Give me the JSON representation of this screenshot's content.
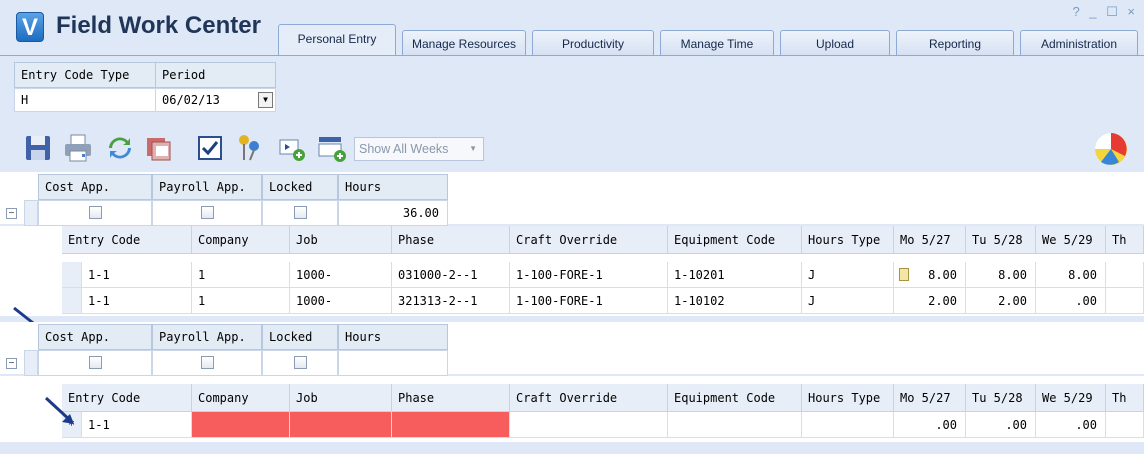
{
  "app": {
    "title": "Field Work Center",
    "logo_letter": "V",
    "window_controls": "? _ ☐ ×"
  },
  "tabs": [
    "Personal Entry",
    "Manage Resources",
    "Productivity",
    "Manage Time",
    "Upload",
    "Reporting",
    "Administration"
  ],
  "filters": {
    "entry_code_type_label": "Entry Code Type",
    "entry_code_type_value": "H",
    "period_label": "Period",
    "period_value": "06/02/13"
  },
  "toolbar": {
    "icons": [
      "save-icon",
      "print-icon",
      "refresh-icon",
      "calendar-icon",
      "checkbox-icon",
      "pin-icon",
      "add-row-icon",
      "add-list-icon",
      "beach-ball-icon"
    ],
    "show_weeks": "Show All Weeks"
  },
  "group_headers": {
    "cost_app": "Cost App.",
    "payroll_app": "Payroll App.",
    "locked": "Locked",
    "hours": "Hours"
  },
  "group1": {
    "hours": "36.00"
  },
  "group2": {
    "hours": ""
  },
  "columns": [
    "Entry Code",
    "Company",
    "Job",
    "Phase",
    "Craft Override",
    "Equipment Code",
    "Hours Type",
    "Mo 5/27",
    "Tu 5/28",
    "We 5/29",
    "Th"
  ],
  "group1_rows": [
    {
      "entry_code": "1-1",
      "company": "1",
      "job": "1000-",
      "phase": "031000-2--1",
      "craft": "1-100-FORE-1",
      "equipment": "1-10201",
      "hours_type": "J",
      "mo": "8.00",
      "tu": "8.00",
      "we": "8.00"
    },
    {
      "entry_code": "1-1",
      "company": "1",
      "job": "1000-",
      "phase": "321313-2--1",
      "craft": "1-100-FORE-1",
      "equipment": "1-10102",
      "hours_type": "J",
      "mo": "2.00",
      "tu": "2.00",
      "we": ".00"
    }
  ],
  "group2_rows": [
    {
      "marker": "*",
      "entry_code": "1-1",
      "company": "",
      "job": "",
      "phase": "",
      "craft": "",
      "equipment": "",
      "hours_type": "",
      "mo": ".00",
      "tu": ".00",
      "we": ".00"
    }
  ]
}
